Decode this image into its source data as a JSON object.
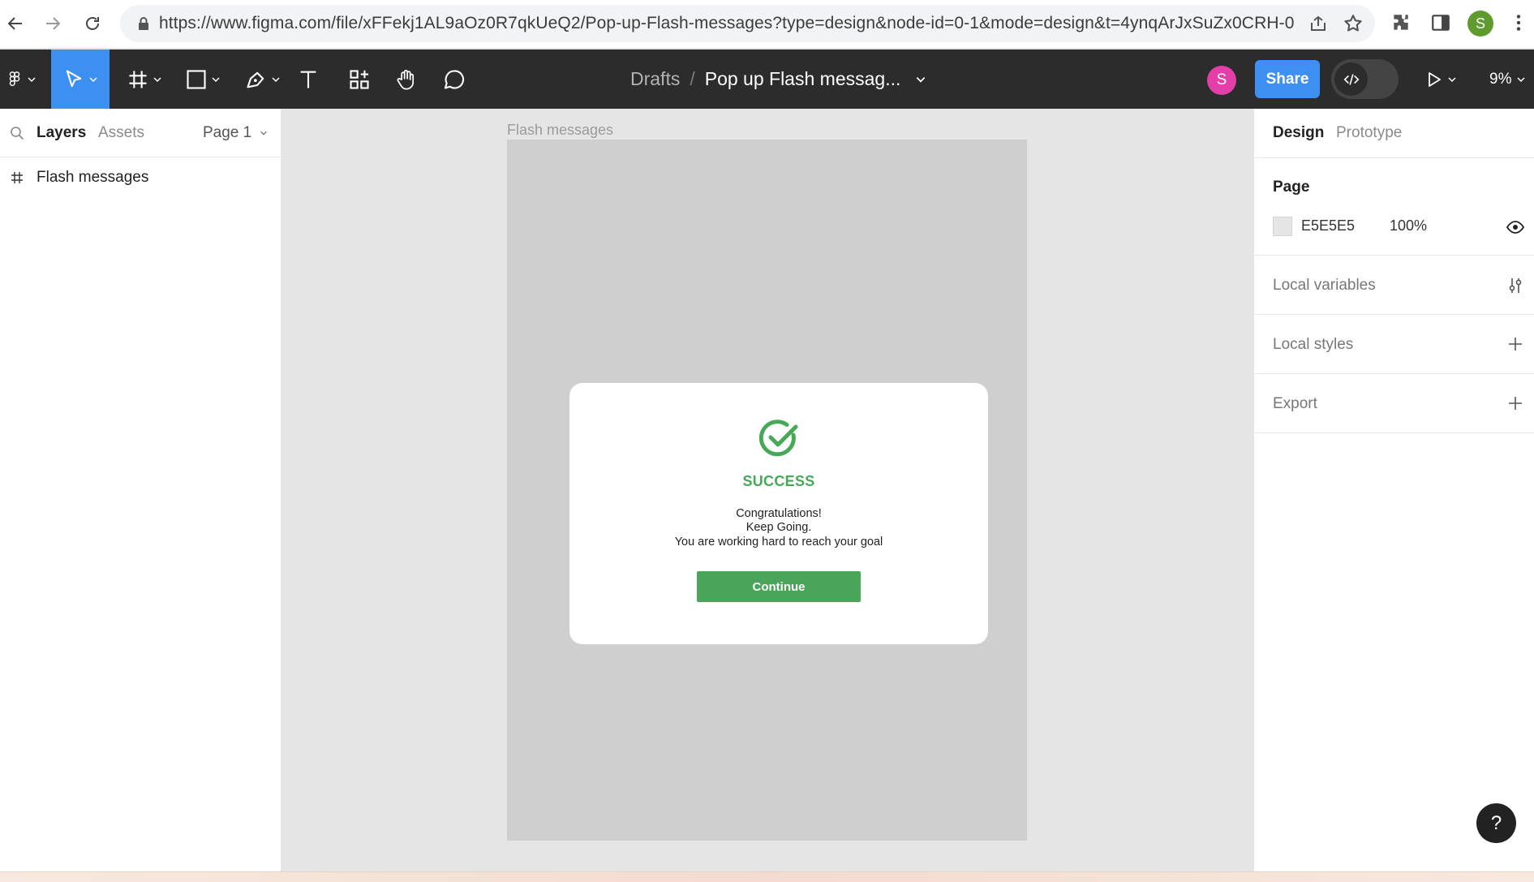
{
  "browser": {
    "url": "https://www.figma.com/file/xFFekj1AL9aOz0R7qkUeQ2/Pop-up-Flash-messages?type=design&node-id=0-1&mode=design&t=4ynqArJxSuZx0CRH-0",
    "profile_initial": "S"
  },
  "toolbar": {
    "breadcrumb_root": "Drafts",
    "breadcrumb_sep": "/",
    "file_name": "Pop up Flash messag...",
    "user_initial": "S",
    "share_label": "Share",
    "zoom": "9%"
  },
  "left_panel": {
    "tabs": [
      "Layers",
      "Assets"
    ],
    "page_selector": "Page 1",
    "layers": [
      {
        "name": "Flash messages",
        "type": "frame"
      }
    ]
  },
  "canvas": {
    "frame_label": "Flash messages",
    "modal": {
      "status": "SUCCESS",
      "lines": [
        "Congratulations!",
        "Keep Going.",
        "You are working hard to reach your goal"
      ],
      "button_label": "Continue",
      "accent": "#4aa45a"
    }
  },
  "right_panel": {
    "tabs": [
      "Design",
      "Prototype"
    ],
    "page_section_title": "Page",
    "page_color_hex": "E5E5E5",
    "page_opacity": "100%",
    "sections": [
      "Local variables",
      "Local styles",
      "Export"
    ]
  },
  "help_label": "?"
}
